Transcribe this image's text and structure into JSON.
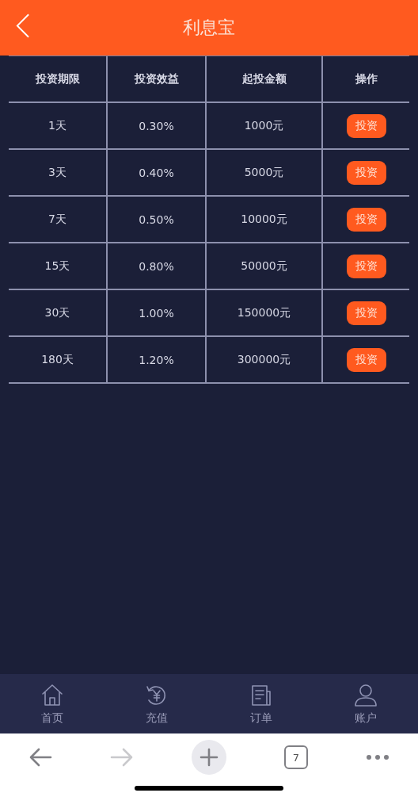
{
  "header": {
    "title": "利息宝"
  },
  "table": {
    "columns": [
      "投资期限",
      "投资效益",
      "起投金额",
      "操作"
    ],
    "rows": [
      {
        "term": "1天",
        "yield": "0.30%",
        "minimum": "1000元",
        "action": "投资"
      },
      {
        "term": "3天",
        "yield": "0.40%",
        "minimum": "5000元",
        "action": "投资"
      },
      {
        "term": "7天",
        "yield": "0.50%",
        "minimum": "10000元",
        "action": "投资"
      },
      {
        "term": "15天",
        "yield": "0.80%",
        "minimum": "50000元",
        "action": "投资"
      },
      {
        "term": "30天",
        "yield": "1.00%",
        "minimum": "150000元",
        "action": "投资"
      },
      {
        "term": "180天",
        "yield": "1.20%",
        "minimum": "300000元",
        "action": "投资"
      }
    ]
  },
  "tab_bar": [
    {
      "kind": "home",
      "label": "首页"
    },
    {
      "kind": "recharge",
      "label": "充值"
    },
    {
      "kind": "orders",
      "label": "订单"
    },
    {
      "kind": "account",
      "label": "账户"
    }
  ],
  "browser_bar": {
    "back_disabled": false,
    "forward_disabled": true,
    "tab_count": "7"
  }
}
